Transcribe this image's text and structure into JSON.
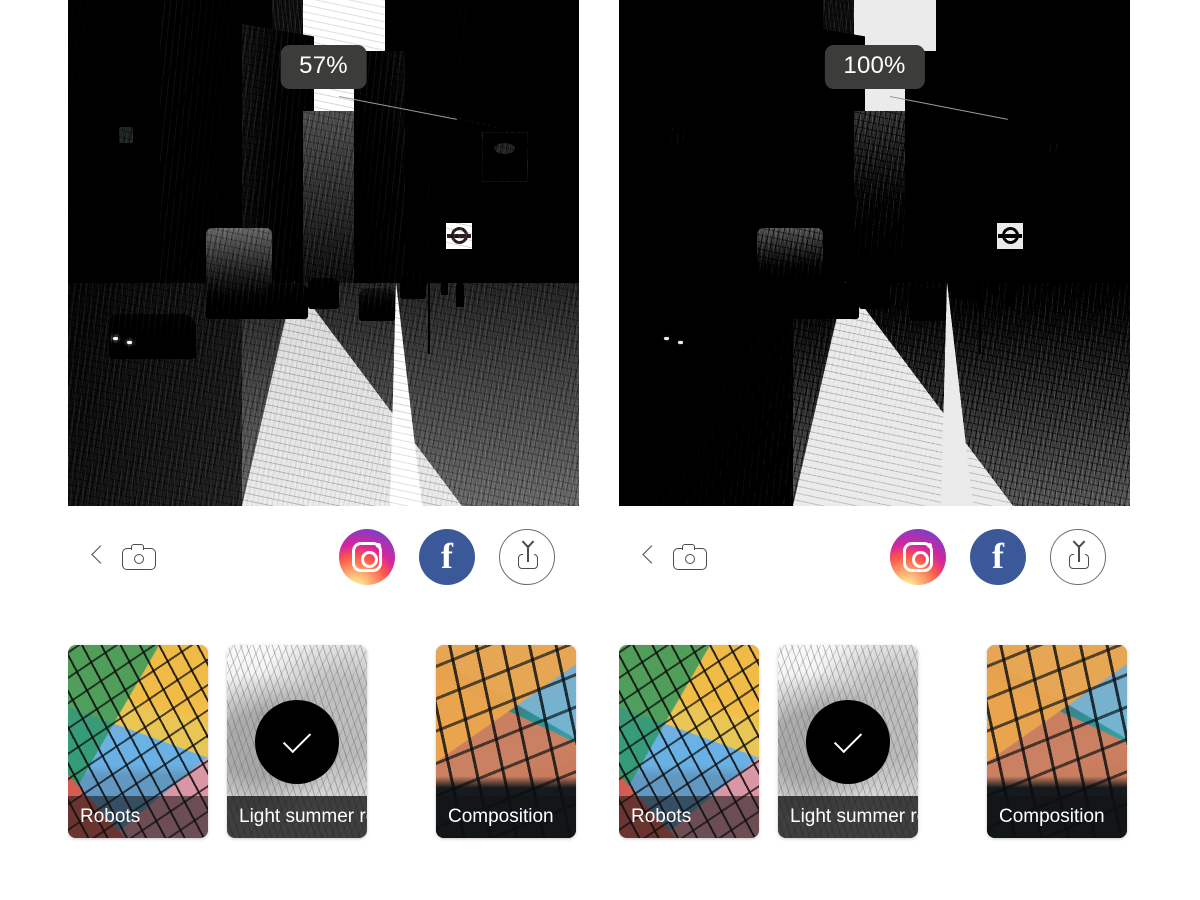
{
  "app": {
    "name": "photo-filter-editor",
    "background_color": "#ffffff"
  },
  "panels": [
    {
      "id": "left",
      "intensity_badge": "57%",
      "preview": {
        "alt_description": "Stylized sketch-filter photo of a narrow city street with parked cars, a van, pedestrians and a London Underground roundel sign",
        "filter_mode": "mid"
      },
      "toolbar": {
        "back_label": "Back",
        "camera_label": "Camera",
        "instagram_label": "Instagram",
        "facebook_label": "Facebook",
        "share_label": "Share"
      },
      "filters": [
        {
          "label": "Robots",
          "art": "artRobots",
          "selected": false
        },
        {
          "label": "Light summer reading",
          "art": "artSketch",
          "selected": true
        },
        {
          "label": "Composition",
          "art": "artComp",
          "selected": false
        }
      ]
    },
    {
      "id": "right",
      "intensity_badge": "100%",
      "preview": {
        "alt_description": "Fully applied high-contrast monochrome sketch-filter version of the same city street photo",
        "filter_mode": "mono"
      },
      "toolbar": {
        "back_label": "Back",
        "camera_label": "Camera",
        "instagram_label": "Instagram",
        "facebook_label": "Facebook",
        "share_label": "Share"
      },
      "filters": [
        {
          "label": "Robots",
          "art": "artRobots",
          "selected": false
        },
        {
          "label": "Light summer reading",
          "art": "artSketch",
          "selected": true
        },
        {
          "label": "Composition",
          "art": "artComp",
          "selected": false
        }
      ]
    }
  ],
  "colors": {
    "badge_background": "#3c3c3b",
    "badge_text": "#ffffff",
    "instagram_gradient_start": "#fdf497",
    "instagram_gradient_mid": "#fd5949",
    "instagram_gradient_end": "#285AEB",
    "facebook_blue": "#3b5998",
    "icon_stroke": "#4c4c4b",
    "selected_badge": "#000000",
    "label_overlay": "rgba(18,18,18,0.78)"
  },
  "icons": {
    "back": "chevron-left-icon",
    "camera": "camera-icon",
    "instagram": "instagram-icon",
    "facebook": "facebook-icon",
    "share": "share-icon",
    "check": "check-icon"
  }
}
